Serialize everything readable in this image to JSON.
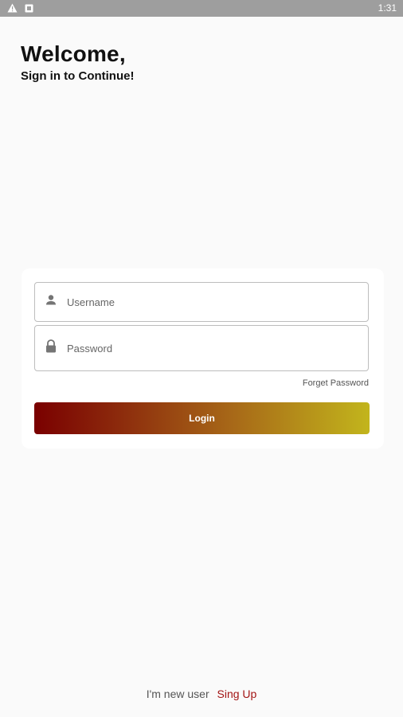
{
  "status_bar": {
    "time": "1:31",
    "icons": [
      "warning-icon",
      "notification-icon"
    ]
  },
  "header": {
    "title": "Welcome,",
    "subtitle": "Sign in to Continue!"
  },
  "form": {
    "username": {
      "placeholder": "Username",
      "value": "",
      "icon": "person-icon"
    },
    "password": {
      "placeholder": "Password",
      "value": "",
      "icon": "lock-icon"
    },
    "forget_password_label": "Forget Password",
    "login_label": "Login"
  },
  "footer": {
    "prompt": "I'm new user",
    "signup_label": "Sing Up"
  },
  "colors": {
    "background": "#fafafa",
    "status_bar": "#9e9e9e",
    "gradient_start": "#7a0000",
    "gradient_end": "#c2b51c",
    "signup_link": "#a31515"
  }
}
